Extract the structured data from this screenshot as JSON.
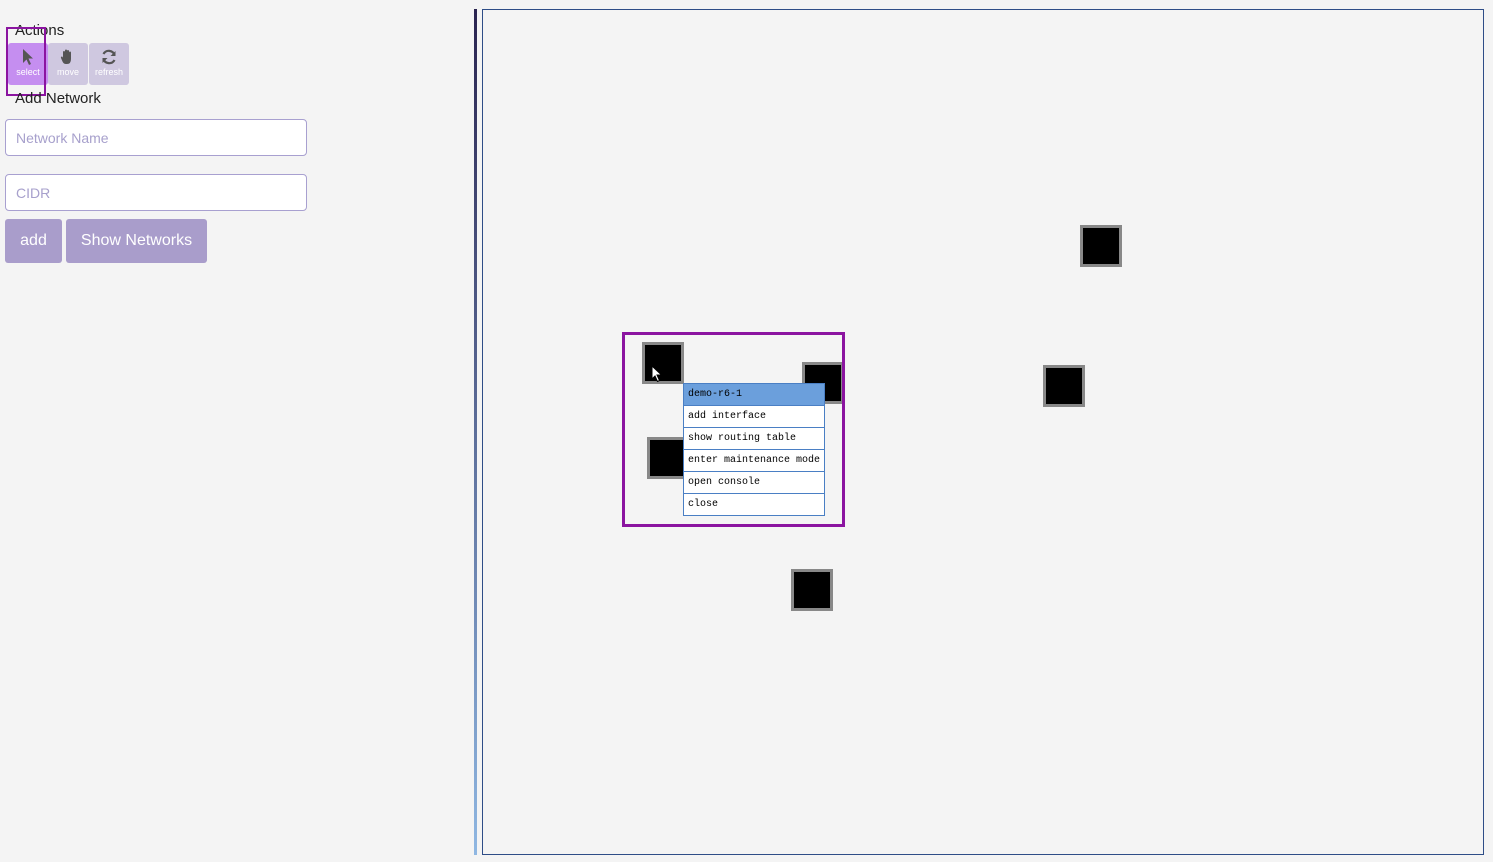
{
  "actions": {
    "title": "Actions",
    "tools": [
      {
        "label": "select",
        "icon": "pointer-icon"
      },
      {
        "label": "move",
        "icon": "hand-icon"
      },
      {
        "label": "refresh",
        "icon": "refresh-icon"
      }
    ]
  },
  "add_network": {
    "title": "Add Network",
    "name_placeholder": "Network Name",
    "cidr_placeholder": "CIDR",
    "add_label": "add",
    "show_label": "Show Networks"
  },
  "context_menu": {
    "title": "demo-r6-1",
    "items": [
      "add interface",
      "show routing table",
      "enter maintenance mode",
      "open console",
      "close"
    ]
  },
  "colors": {
    "active_tool": "#c58ef0",
    "tool": "#cfc8e0",
    "button": "#a99dcb",
    "selection": "#8b14a0",
    "menu_header": "#6b9fdc"
  }
}
